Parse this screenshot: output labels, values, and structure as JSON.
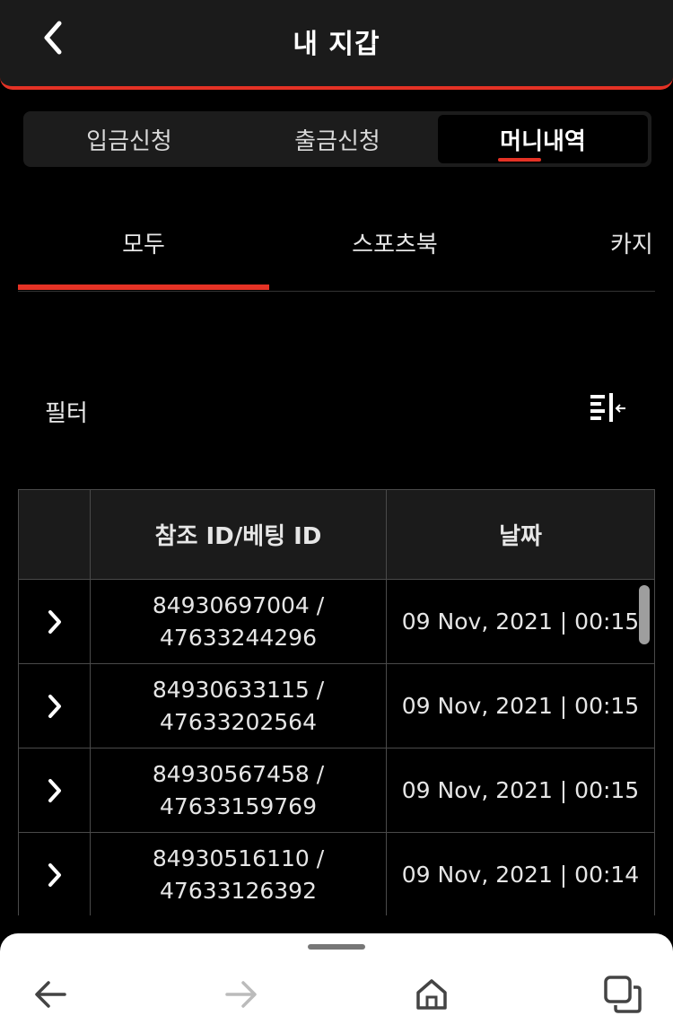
{
  "header": {
    "title": "내 지갑"
  },
  "segment_tabs": [
    {
      "label": "입금신청",
      "active": false
    },
    {
      "label": "출금신청",
      "active": false
    },
    {
      "label": "머니내역",
      "active": true
    }
  ],
  "sub_tabs": [
    {
      "label": "모두",
      "active": true
    },
    {
      "label": "스포츠북",
      "active": false
    },
    {
      "label": "카지",
      "active": false
    }
  ],
  "filter": {
    "label": "필터",
    "icon": "filter-sort-icon"
  },
  "table": {
    "columns": [
      "",
      "참조 ID/베팅 ID",
      "날짜"
    ],
    "rows": [
      {
        "ref_id": "84930697004 /",
        "bet_id": "47633244296",
        "date": "09 Nov, 2021 | 00:15"
      },
      {
        "ref_id": "84930633115 /",
        "bet_id": "47633202564",
        "date": "09 Nov, 2021 | 00:15"
      },
      {
        "ref_id": "84930567458 /",
        "bet_id": "47633159769",
        "date": "09 Nov, 2021 | 00:15"
      },
      {
        "ref_id": "84930516110 /",
        "bet_id": "47633126392",
        "date": "09 Nov, 2021 | 00:14"
      }
    ]
  },
  "colors": {
    "accent": "#e53225",
    "header_bg": "#1b1b1b",
    "background": "#000000",
    "border": "#4a4a4a"
  },
  "browser_bar": {
    "icons": [
      "back-arrow-icon",
      "forward-arrow-icon",
      "home-icon",
      "tabs-icon"
    ]
  }
}
